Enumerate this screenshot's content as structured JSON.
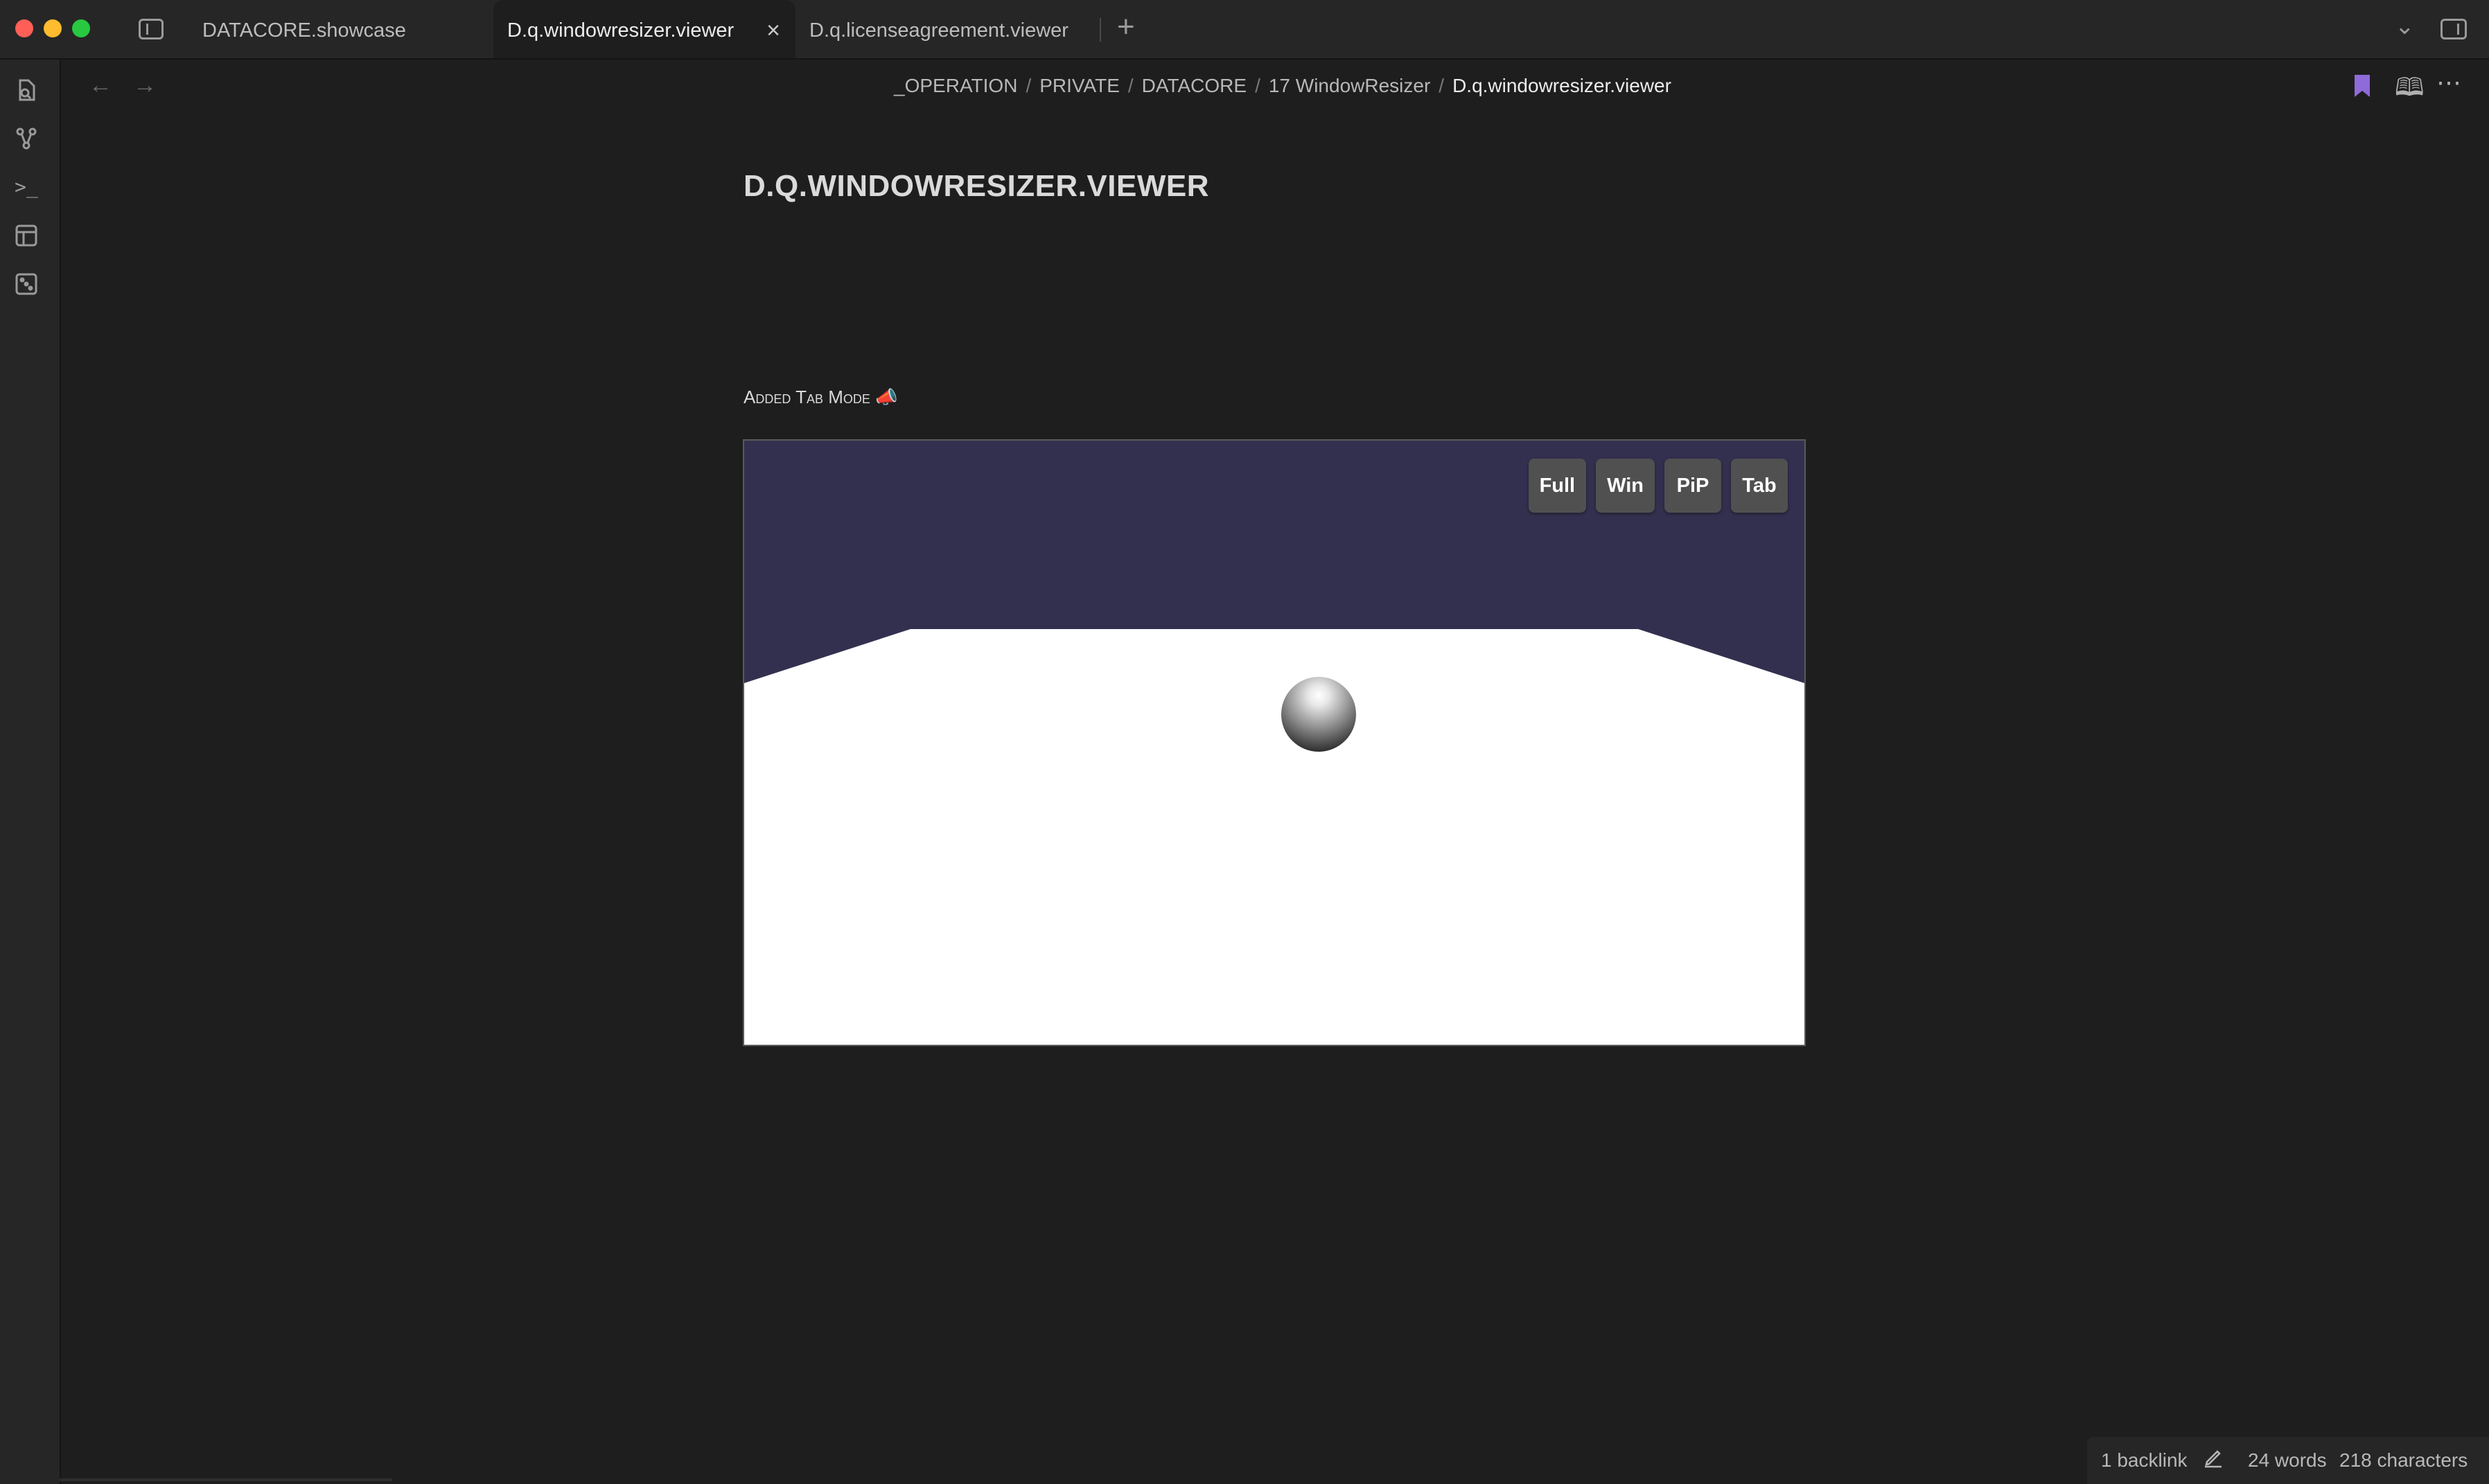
{
  "window": {
    "tabs": [
      {
        "label": "DATACORE.showcase",
        "active": false
      },
      {
        "label": "D.q.windowresizer.viewer",
        "active": true
      },
      {
        "label": "D.q.licenseagreement.viewer",
        "active": false
      }
    ],
    "new_tab_glyph": "+",
    "close_glyph": "×",
    "tab_list_glyph": "⌄"
  },
  "ribbon": {
    "icons": [
      "files-icon",
      "graph-icon",
      "terminal-icon",
      "templates-icon",
      "random-note-icon"
    ],
    "terminal_glyph": ">_"
  },
  "nav": {
    "back_glyph": "←",
    "forward_glyph": "→"
  },
  "breadcrumb": {
    "items": [
      "_OPERATION",
      "PRIVATE",
      "DATACORE",
      "17 WindowResizer"
    ],
    "separator": "/",
    "current": "D.q.windowresizer.viewer"
  },
  "header_actions": {
    "bookmark_color": "#8f6bd9",
    "reading_glyph": "🕮",
    "more_glyph": "⋯"
  },
  "note": {
    "title": "D.q.windowresizer.viewer",
    "line_text": "Added Tab Mode",
    "line_emoji": "📣"
  },
  "viewer": {
    "buttons": [
      "Full",
      "Win",
      "PiP",
      "Tab"
    ],
    "sky_color": "#33304f",
    "floor_color": "#ffffff"
  },
  "status": {
    "backlinks": "1 backlink",
    "words": "24 words",
    "characters": "218 characters"
  }
}
